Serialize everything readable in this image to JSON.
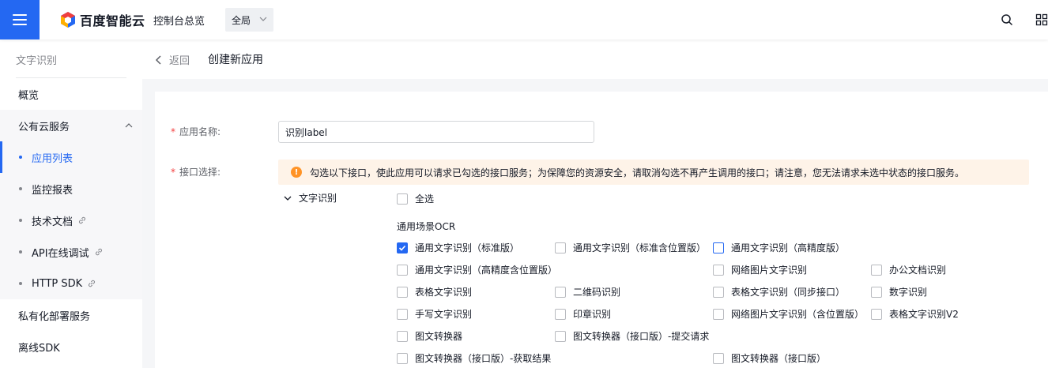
{
  "topbar": {
    "logo_text": "百度智能云",
    "console_link": "控制台总览",
    "scope": "全局"
  },
  "sidebar": {
    "title": "文字识别",
    "overview": "概览",
    "group": "公有云服务",
    "sub_items": [
      "应用列表",
      "监控报表",
      "技术文档",
      "API在线调试",
      "HTTP SDK"
    ],
    "private_deploy": "私有化部署服务",
    "offline_sdk": "离线SDK"
  },
  "header": {
    "back": "返回",
    "title": "创建新应用"
  },
  "form": {
    "app_name_label": "应用名称:",
    "app_name_value": "识别label",
    "api_label": "接口选择:",
    "notice": "勾选以下接口，使此应用可以请求已勾选的接口服务；为保障您的资源安全，请取消勾选不再产生调用的接口；请注意，您无法请求未选中状态的接口服务。",
    "tree_node": "文字识别",
    "select_all": "全选",
    "section_title": "通用场景OCR",
    "options": [
      "通用文字识别（标准版）",
      "通用文字识别（标准含位置版）",
      "通用文字识别（高精度版）",
      "通用文字识别（高精度含位置版）",
      "网络图片文字识别",
      "办公文档识别",
      "表格文字识别",
      "二维码识别",
      "表格文字识别（同步接口）",
      "数字识别",
      "手写文字识别",
      "印章识别",
      "网络图片文字识别（含位置版）",
      "表格文字识别V2",
      "图文转换器",
      "图文转换器（接口版）-提交请求",
      "图文转换器（接口版）-获取结果",
      "图文转换器（接口版）"
    ]
  },
  "colors": {
    "brand": "#2468f2",
    "warning": "#ff9326",
    "required": "#f33e3e"
  }
}
